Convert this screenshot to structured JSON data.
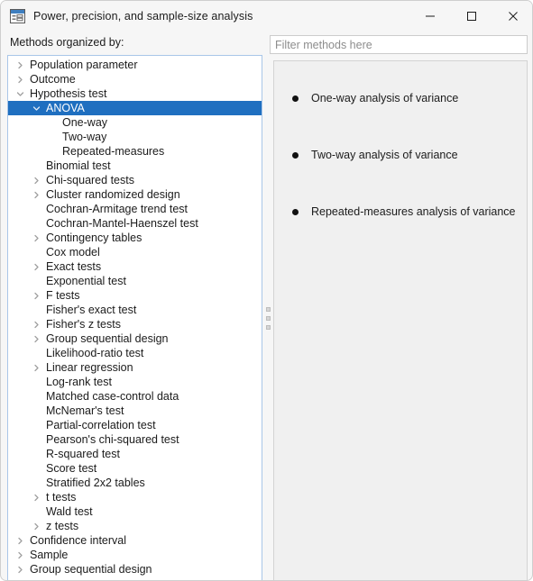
{
  "window": {
    "title": "Power, precision, and sample-size analysis",
    "icon": "form-window-icon",
    "controls": [
      {
        "name": "minimize-button",
        "glyph": "minimize-icon",
        "label": "Minimize"
      },
      {
        "name": "maximize-button",
        "glyph": "maximize-icon",
        "label": "Maximize"
      },
      {
        "name": "close-button",
        "glyph": "close-icon",
        "label": "Close"
      }
    ]
  },
  "left": {
    "label": "Methods organized by:"
  },
  "filter": {
    "value": "",
    "placeholder": "Filter methods here"
  },
  "colors": {
    "selection": "#1f6fc0",
    "tree_border": "#a9c6e8",
    "panel_bg": "#f0f0f0",
    "window_bg": "#f6f6f6"
  },
  "tree": {
    "items": [
      {
        "label": "Population parameter",
        "level": 1,
        "state": "collapsed",
        "selected": false
      },
      {
        "label": "Outcome",
        "level": 1,
        "state": "collapsed",
        "selected": false
      },
      {
        "label": "Hypothesis test",
        "level": 1,
        "state": "expanded",
        "selected": false
      },
      {
        "label": "ANOVA",
        "level": 2,
        "state": "expanded",
        "selected": true
      },
      {
        "label": "One-way",
        "level": 3,
        "state": "leaf",
        "selected": false
      },
      {
        "label": "Two-way",
        "level": 3,
        "state": "leaf",
        "selected": false
      },
      {
        "label": "Repeated-measures",
        "level": 3,
        "state": "leaf",
        "selected": false
      },
      {
        "label": "Binomial test",
        "level": 2,
        "state": "leaf",
        "selected": false
      },
      {
        "label": "Chi-squared tests",
        "level": 2,
        "state": "collapsed",
        "selected": false
      },
      {
        "label": "Cluster randomized design",
        "level": 2,
        "state": "collapsed",
        "selected": false
      },
      {
        "label": "Cochran-Armitage trend test",
        "level": 2,
        "state": "leaf",
        "selected": false
      },
      {
        "label": "Cochran-Mantel-Haenszel test",
        "level": 2,
        "state": "leaf",
        "selected": false
      },
      {
        "label": "Contingency tables",
        "level": 2,
        "state": "collapsed",
        "selected": false
      },
      {
        "label": "Cox model",
        "level": 2,
        "state": "leaf",
        "selected": false
      },
      {
        "label": "Exact tests",
        "level": 2,
        "state": "collapsed",
        "selected": false
      },
      {
        "label": "Exponential test",
        "level": 2,
        "state": "leaf",
        "selected": false
      },
      {
        "label": "F tests",
        "level": 2,
        "state": "collapsed",
        "selected": false
      },
      {
        "label": "Fisher's exact test",
        "level": 2,
        "state": "leaf",
        "selected": false
      },
      {
        "label": "Fisher's z tests",
        "level": 2,
        "state": "collapsed",
        "selected": false
      },
      {
        "label": "Group sequential design",
        "level": 2,
        "state": "collapsed",
        "selected": false
      },
      {
        "label": "Likelihood-ratio test",
        "level": 2,
        "state": "leaf",
        "selected": false
      },
      {
        "label": "Linear regression",
        "level": 2,
        "state": "collapsed",
        "selected": false
      },
      {
        "label": "Log-rank test",
        "level": 2,
        "state": "leaf",
        "selected": false
      },
      {
        "label": "Matched case-control data",
        "level": 2,
        "state": "leaf",
        "selected": false
      },
      {
        "label": "McNemar's test",
        "level": 2,
        "state": "leaf",
        "selected": false
      },
      {
        "label": "Partial-correlation test",
        "level": 2,
        "state": "leaf",
        "selected": false
      },
      {
        "label": "Pearson's chi-squared test",
        "level": 2,
        "state": "leaf",
        "selected": false
      },
      {
        "label": "R-squared test",
        "level": 2,
        "state": "leaf",
        "selected": false
      },
      {
        "label": "Score test",
        "level": 2,
        "state": "leaf",
        "selected": false
      },
      {
        "label": "Stratified 2x2 tables",
        "level": 2,
        "state": "leaf",
        "selected": false
      },
      {
        "label": "t tests",
        "level": 2,
        "state": "collapsed",
        "selected": false
      },
      {
        "label": "Wald test",
        "level": 2,
        "state": "leaf",
        "selected": false
      },
      {
        "label": "z tests",
        "level": 2,
        "state": "collapsed",
        "selected": false
      },
      {
        "label": "Confidence interval",
        "level": 1,
        "state": "collapsed",
        "selected": false
      },
      {
        "label": "Sample",
        "level": 1,
        "state": "collapsed",
        "selected": false
      },
      {
        "label": "Group sequential design",
        "level": 1,
        "state": "collapsed",
        "selected": false
      }
    ]
  },
  "results": {
    "items": [
      {
        "label": "One-way analysis of variance"
      },
      {
        "label": "Two-way analysis of variance"
      },
      {
        "label": "Repeated-measures analysis of variance"
      }
    ]
  },
  "splitter": {
    "grip_dots": 3
  }
}
